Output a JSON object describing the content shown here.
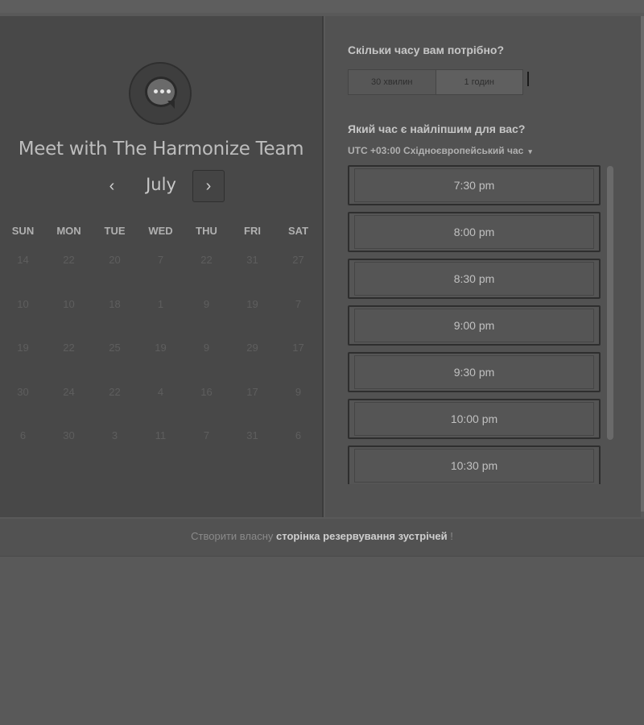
{
  "widget": {
    "title": "Meet with The Harmonize Team",
    "month": "July",
    "prev_icon": "‹",
    "next_icon": "›",
    "weekdays": [
      "SUN",
      "MON",
      "TUE",
      "WED",
      "THU",
      "FRI",
      "SAT"
    ],
    "days": [
      "14",
      "22",
      "20",
      "7",
      "22",
      "31",
      "27",
      "10",
      "10",
      "18",
      "1",
      "9",
      "19",
      "7",
      "19",
      "22",
      "25",
      "19",
      "9",
      "29",
      "17",
      "30",
      "24",
      "22",
      "4",
      "16",
      "17",
      "9",
      "6",
      "30",
      "3",
      "11",
      "7",
      "31",
      "6"
    ]
  },
  "duration": {
    "question": "Скільки часу вам потрібно?",
    "options": [
      "30 хвилин",
      "1 годин"
    ]
  },
  "time": {
    "question": "Який час є найліпшим для вас?",
    "timezone": "UTC +03:00 Східноєвропейський час",
    "timezone_caret": "▾",
    "slots": [
      "7:30 pm",
      "8:00 pm",
      "8:30 pm",
      "9:00 pm",
      "9:30 pm",
      "10:00 pm",
      "10:30 pm"
    ]
  },
  "footer": {
    "prefix": "Створити власну",
    "link": "сторінка резервування зустрічей",
    "suffix": "!"
  }
}
